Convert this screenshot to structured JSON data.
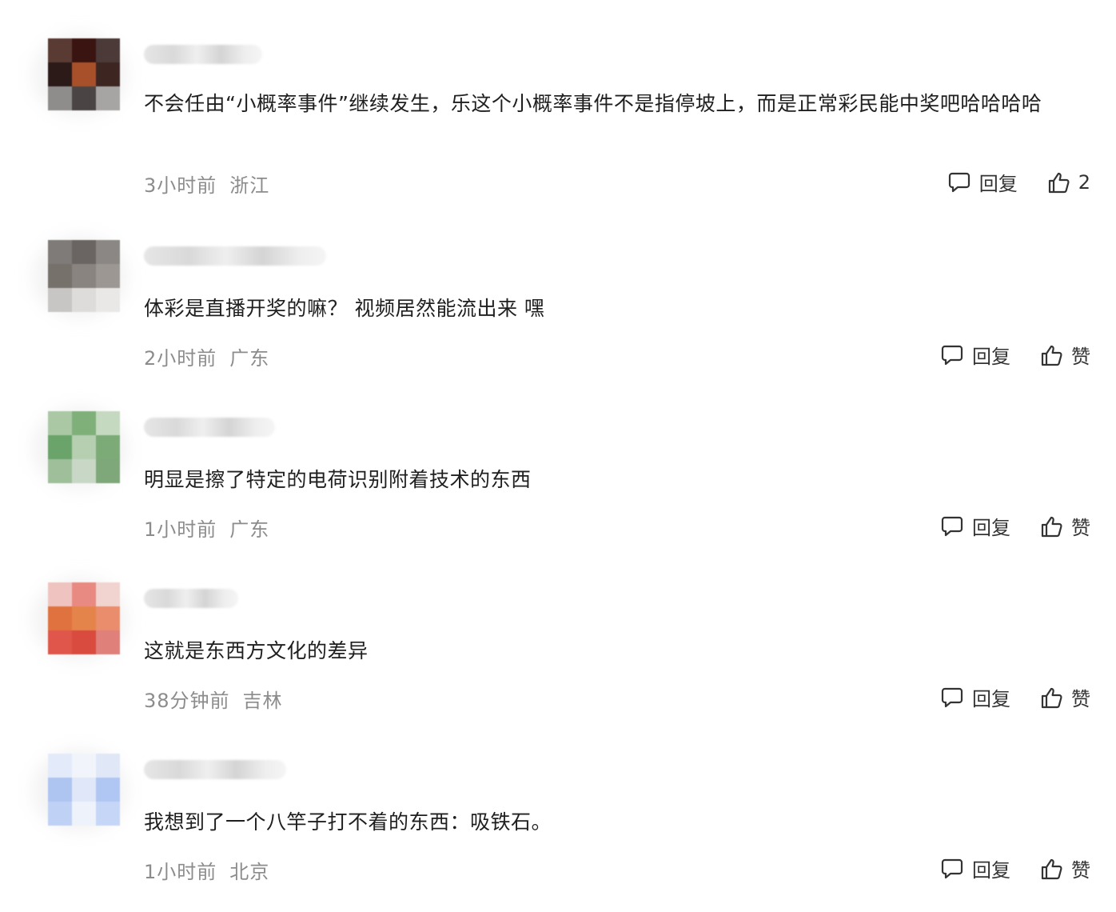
{
  "comments": [
    {
      "content": "不会任由“小概率事件”继续发生，乐这个小概率事件不是指停坡上，而是正常彩民能中奖吧哈哈哈哈",
      "time": "3小时前",
      "location": "浙江",
      "reply_label": "回复",
      "like_label": "2",
      "avatar_colors": [
        "#5a3b34",
        "#3a1410",
        "#4b3a37",
        "#2b1a18",
        "#a8502a",
        "#3d2622",
        "#8f8d8c",
        "#4a4544",
        "#a7a5a4"
      ]
    },
    {
      "content": "体彩是直播开奖的嘛？ 视频居然能流出来 嘿",
      "time": "2小时前",
      "location": "广东",
      "reply_label": "回复",
      "like_label": "赞",
      "avatar_colors": [
        "#7f7b78",
        "#6a6562",
        "#8b8784",
        "#77716c",
        "#8a8480",
        "#9c9792",
        "#c8c6c4",
        "#dedcda",
        "#e9e8e7"
      ]
    },
    {
      "content": "明显是擦了特定的电荷识别附着技术的东西",
      "time": "1小时前",
      "location": "广东",
      "reply_label": "回复",
      "like_label": "赞",
      "avatar_colors": [
        "#a9c8a3",
        "#80b07a",
        "#c4d9bf",
        "#6aa46a",
        "#b6cfb1",
        "#7cab78",
        "#9fbf9b",
        "#c9d8c6",
        "#7ea87a"
      ]
    },
    {
      "content": "这就是东西方文化的差异",
      "time": "38分钟前",
      "location": "吉林",
      "reply_label": "回复",
      "like_label": "赞",
      "avatar_colors": [
        "#efc4c0",
        "#e88a82",
        "#f1d3cf",
        "#e0723f",
        "#e5844a",
        "#e98d6c",
        "#e0564a",
        "#d94b3e",
        "#e0807a"
      ]
    },
    {
      "content": "我想到了一个八竿子打不着的东西：吸铁石。",
      "time": "1小时前",
      "location": "北京",
      "reply_label": "回复",
      "like_label": "赞",
      "avatar_colors": [
        "#e3ebfb",
        "#f1f4fb",
        "#e0e8f8",
        "#aec5f2",
        "#dfe7f8",
        "#b0c7f3",
        "#bfd1f5",
        "#eef2fb",
        "#c6d6f6"
      ]
    }
  ]
}
